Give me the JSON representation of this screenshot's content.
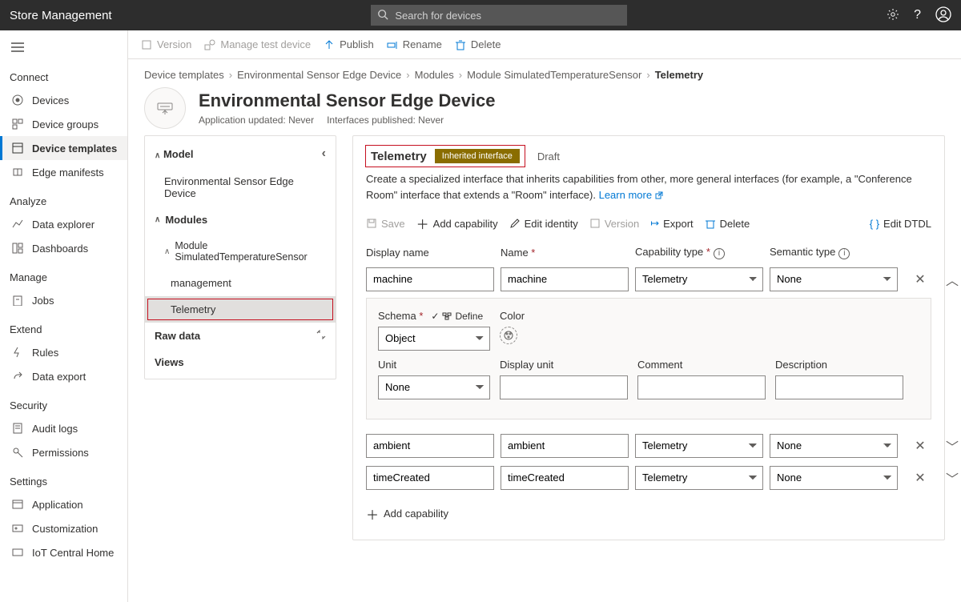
{
  "app_title": "Store Management",
  "search": {
    "placeholder": "Search for devices"
  },
  "sidenav": {
    "sections": [
      {
        "label": "Connect",
        "items": [
          {
            "label": "Devices"
          },
          {
            "label": "Device groups"
          },
          {
            "label": "Device templates",
            "selected": true
          },
          {
            "label": "Edge manifests"
          }
        ]
      },
      {
        "label": "Analyze",
        "items": [
          {
            "label": "Data explorer"
          },
          {
            "label": "Dashboards"
          }
        ]
      },
      {
        "label": "Manage",
        "items": [
          {
            "label": "Jobs"
          }
        ]
      },
      {
        "label": "Extend",
        "items": [
          {
            "label": "Rules"
          },
          {
            "label": "Data export"
          }
        ]
      },
      {
        "label": "Security",
        "items": [
          {
            "label": "Audit logs"
          },
          {
            "label": "Permissions"
          }
        ]
      },
      {
        "label": "Settings",
        "items": [
          {
            "label": "Application"
          },
          {
            "label": "Customization"
          },
          {
            "label": "IoT Central Home"
          }
        ]
      }
    ]
  },
  "cmdbar": {
    "version": "Version",
    "manage_test": "Manage test device",
    "publish": "Publish",
    "rename": "Rename",
    "delete": "Delete"
  },
  "breadcrumb": [
    "Device templates",
    "Environmental Sensor Edge Device",
    "Modules",
    "Module SimulatedTemperatureSensor",
    "Telemetry"
  ],
  "page_title": "Environmental Sensor Edge Device",
  "page_meta": {
    "app_updated": "Application updated: Never",
    "interfaces_published": "Interfaces published: Never"
  },
  "tree": {
    "nodes": [
      {
        "label": "Model",
        "level": 0
      },
      {
        "label": "Environmental Sensor Edge Device",
        "level": 1
      },
      {
        "label": "Modules",
        "level": 0
      },
      {
        "label": "Module SimulatedTemperatureSensor",
        "level": 1
      },
      {
        "label": "management",
        "level": 2
      },
      {
        "label": "Telemetry",
        "level": 2,
        "selected": true,
        "highlighted": true
      },
      {
        "label": "Raw data",
        "level": 0,
        "trailing_icon": "expand-arrows"
      },
      {
        "label": "Views",
        "level": 0
      }
    ]
  },
  "panel": {
    "title": "Telemetry",
    "badge": "Inherited interface",
    "status": "Draft",
    "desc_pre": "Create a specialized interface that inherits capabilities from other, more general interfaces (for example, a \"Conference Room\" interface that extends a \"Room\" interface). ",
    "learn_more": "Learn more",
    "toolbar": {
      "save": "Save",
      "add_capability": "Add capability",
      "edit_identity": "Edit identity",
      "version": "Version",
      "export": "Export",
      "delete": "Delete",
      "edit_dtdl": "Edit DTDL"
    },
    "columns": {
      "display_name": "Display name",
      "name": "Name",
      "capability_type": "Capability type",
      "semantic_type": "Semantic type"
    },
    "capabilities": [
      {
        "display_name": "machine",
        "name": "machine",
        "capability_type": "Telemetry",
        "semantic_type": "None",
        "expanded": true
      },
      {
        "display_name": "ambient",
        "name": "ambient",
        "capability_type": "Telemetry",
        "semantic_type": "None"
      },
      {
        "display_name": "timeCreated",
        "name": "timeCreated",
        "capability_type": "Telemetry",
        "semantic_type": "None"
      }
    ],
    "detail": {
      "schema_label": "Schema",
      "define": "Define",
      "schema_value": "Object",
      "color_label": "Color",
      "unit_label": "Unit",
      "unit_value": "None",
      "display_unit_label": "Display unit",
      "comment_label": "Comment",
      "description_label": "Description"
    },
    "add_capability": "Add capability"
  }
}
